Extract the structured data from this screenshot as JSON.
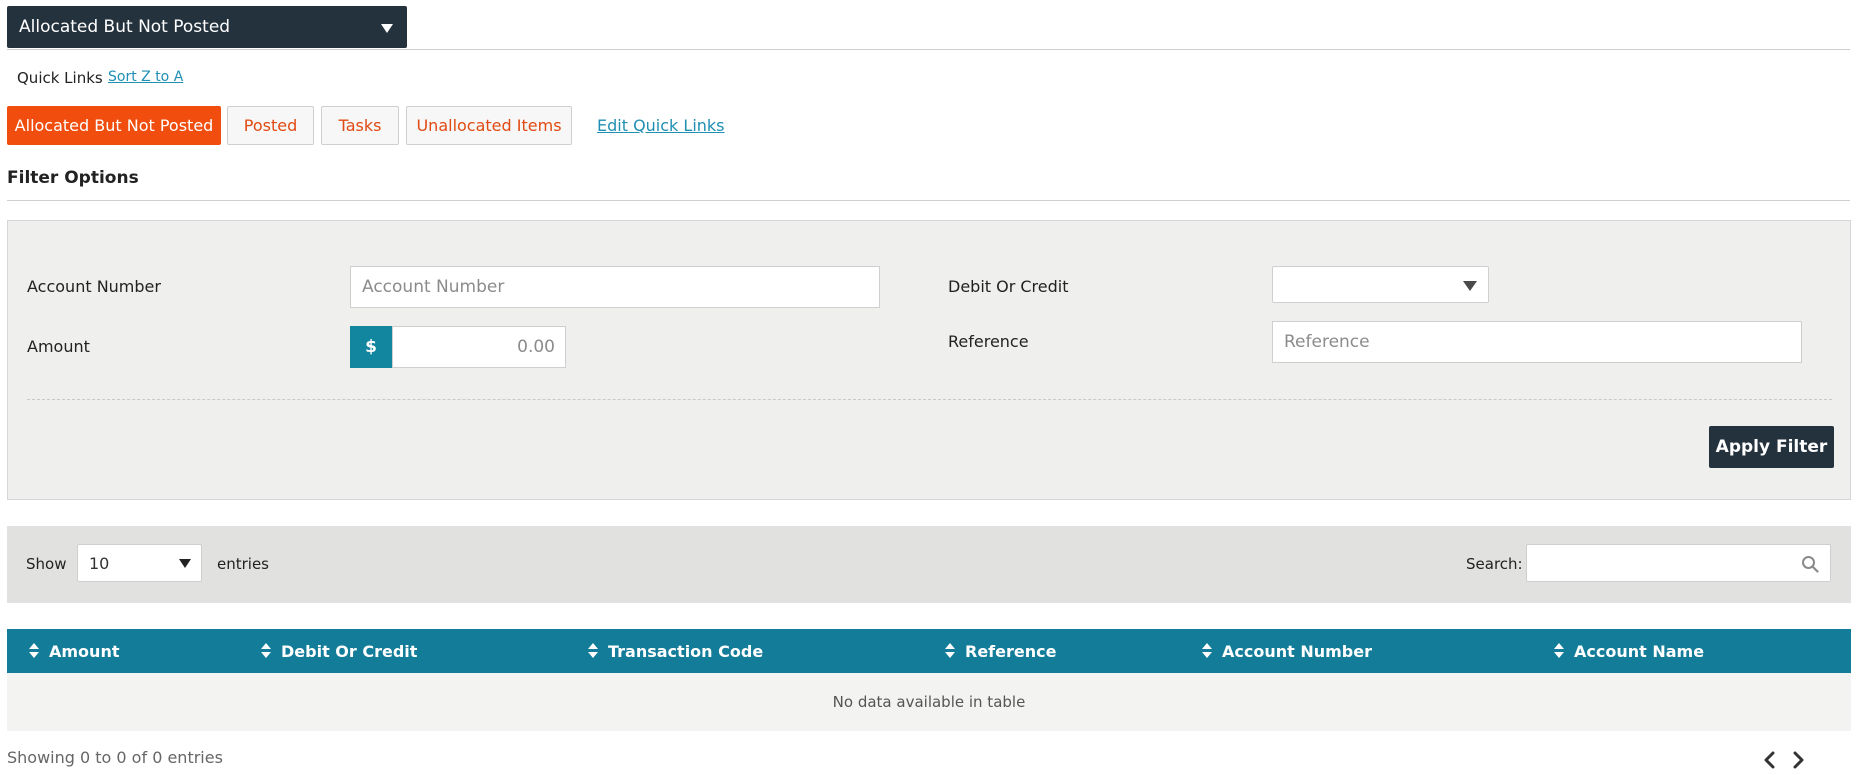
{
  "view_selector": {
    "label": "Allocated But Not Posted"
  },
  "quick_links": {
    "label": "Quick Links",
    "sort_link": "Sort Z to A",
    "items": [
      {
        "label": "Allocated But Not Posted",
        "active": true
      },
      {
        "label": "Posted",
        "active": false
      },
      {
        "label": "Tasks",
        "active": false
      },
      {
        "label": "Unallocated Items",
        "active": false
      }
    ],
    "edit_link": "Edit Quick Links"
  },
  "filter": {
    "title": "Filter Options",
    "account_number": {
      "label": "Account Number",
      "placeholder": "Account Number",
      "value": ""
    },
    "amount": {
      "label": "Amount",
      "currency_symbol": "$",
      "placeholder": "0.00",
      "value": ""
    },
    "debit_or_credit": {
      "label": "Debit Or Credit",
      "selected": ""
    },
    "reference": {
      "label": "Reference",
      "placeholder": "Reference",
      "value": ""
    },
    "apply_label": "Apply Filter"
  },
  "table_controls": {
    "show_label": "Show",
    "page_size": "10",
    "entries_label": "entries",
    "search_label": "Search:",
    "search_value": ""
  },
  "table": {
    "columns": [
      "Amount",
      "Debit Or Credit",
      "Transaction Code",
      "Reference",
      "Account Number",
      "Account Name"
    ],
    "rows": [],
    "empty_message": "No data available in table"
  },
  "footer": {
    "info": "Showing 0 to 0 of 0 entries",
    "prev_icon": "chevron-left-icon",
    "next_icon": "chevron-right-icon"
  },
  "colors": {
    "accent_orange": "#f04d0e",
    "header_dark": "#24323e",
    "table_header_teal": "#127c99",
    "link_blue": "#1f8fb3"
  }
}
